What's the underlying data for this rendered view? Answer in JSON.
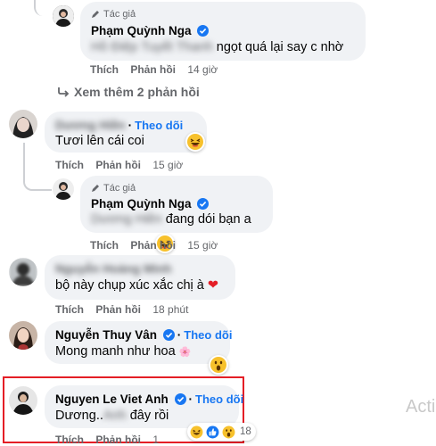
{
  "comments": [
    {
      "author_badge": "Tác giả",
      "name": "Phạm Quỳnh Nga",
      "text_blurred": "Hồ Điệp Tuyết Thanh",
      "text": "ngọt quá lại say c nhờ",
      "actions": [
        "Thích",
        "Phản hồi"
      ],
      "time": "14 giờ"
    },
    {
      "view_more": "Xem thêm 2 phản hồi"
    },
    {
      "name_blurred": "Dương Hiền",
      "follow": "Theo dõi",
      "text": "Tươi lên cái coi",
      "actions": [
        "Thích",
        "Phản hồi"
      ],
      "time": "15 giờ",
      "reaction": "haha"
    },
    {
      "author_badge": "Tác giả",
      "name": "Phạm Quỳnh Nga",
      "text_blurred": "Dương Hiền",
      "text": "đang dói bạn a",
      "actions": [
        "Thích",
        "Phản hồi"
      ],
      "time": "15 giờ",
      "reaction": "haha"
    },
    {
      "name_blurred": "Nguyễn Hoàng Minh",
      "text": "bộ này chụp xúc xắc chị à",
      "heart": "❤",
      "actions": [
        "Thích",
        "Phản hồi"
      ],
      "time": "18 phút"
    },
    {
      "name": "Nguyễn Thuy Vân",
      "follow": "Theo dõi",
      "text": "Mong manh như hoa",
      "flower": "🌸",
      "actions": [
        "Thích",
        "Phản hồi"
      ],
      "time": "",
      "reaction": "wow"
    },
    {
      "name": "Nguyen Le Viet Anh",
      "follow": "Theo dõi",
      "text_a": "Dương..",
      "text_blurred": "Anh",
      "text_b": "đây rồi",
      "actions": [
        "Thích",
        "Phản hồi"
      ],
      "time": "1",
      "reaction_count": "18"
    }
  ],
  "watermark": "Acti",
  "colors": {
    "link": "#1877f2",
    "bubble": "#f0f2f5",
    "highlight": "#e41e26",
    "meta": "#65676b"
  }
}
